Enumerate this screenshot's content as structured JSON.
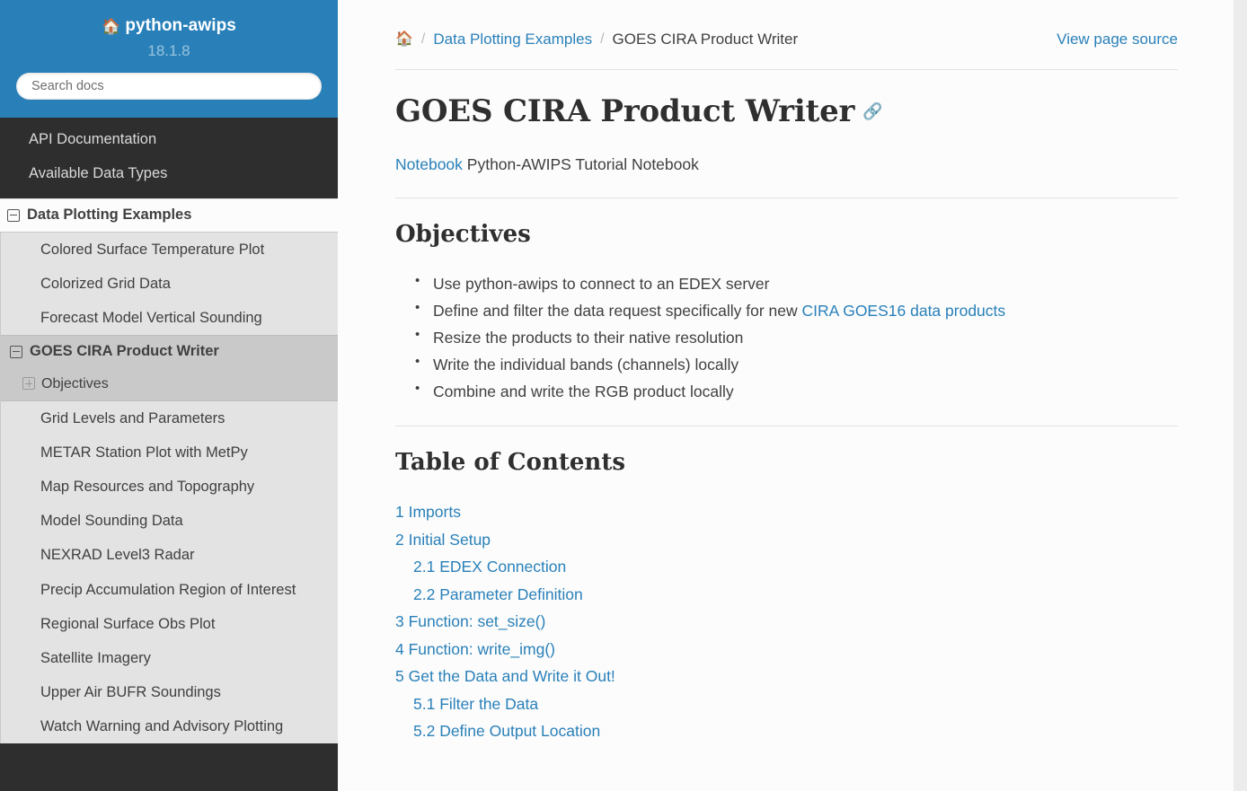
{
  "sidebar": {
    "brand": "python-awips",
    "brand_icon": "home-icon",
    "version": "18.1.8",
    "search_placeholder": "Search docs",
    "top_items": [
      {
        "label": "API Documentation"
      },
      {
        "label": "Available Data Types"
      }
    ],
    "current_root": {
      "label": "Data Plotting Examples",
      "toggle": "minus-box-icon"
    },
    "items": [
      {
        "label": "Colored Surface Temperature Plot",
        "active": false
      },
      {
        "label": "Colorized Grid Data",
        "active": false
      },
      {
        "label": "Forecast Model Vertical Sounding",
        "active": false
      },
      {
        "label": "GOES CIRA Product Writer",
        "active": true,
        "toggle": "minus-box-icon",
        "children": [
          {
            "label": "Objectives",
            "toggle": "plus-box-icon"
          }
        ]
      },
      {
        "label": "Grid Levels and Parameters",
        "active": false
      },
      {
        "label": "METAR Station Plot with MetPy",
        "active": false
      },
      {
        "label": "Map Resources and Topography",
        "active": false
      },
      {
        "label": "Model Sounding Data",
        "active": false
      },
      {
        "label": "NEXRAD Level3 Radar",
        "active": false
      },
      {
        "label": "Precip Accumulation Region of Interest",
        "active": false
      },
      {
        "label": "Regional Surface Obs Plot",
        "active": false
      },
      {
        "label": "Satellite Imagery",
        "active": false
      },
      {
        "label": "Upper Air BUFR Soundings",
        "active": false
      },
      {
        "label": "Watch Warning and Advisory Plotting",
        "active": false
      }
    ]
  },
  "breadcrumb": {
    "home_icon": "home-icon",
    "separator": "/",
    "parent": "Data Plotting Examples",
    "current": "GOES CIRA Product Writer",
    "view_source": "View page source"
  },
  "main": {
    "title": "GOES CIRA Product Writer",
    "headerlink_icon": "permalink-chain-icon",
    "lead_link": "Notebook",
    "lead_text": " Python-AWIPS Tutorial Notebook",
    "objectives_heading": "Objectives",
    "objectives": [
      {
        "pre": "Use python-awips to connect to an EDEX server",
        "link": "",
        "post": ""
      },
      {
        "pre": "Define and filter the data request specifically for new ",
        "link": "CIRA GOES16 data products",
        "post": ""
      },
      {
        "pre": "Resize the products to their native resolution",
        "link": "",
        "post": ""
      },
      {
        "pre": "Write the individual bands (channels) locally",
        "link": "",
        "post": ""
      },
      {
        "pre": "Combine and write the RGB product locally",
        "link": "",
        "post": ""
      }
    ],
    "toc_heading": "Table of Contents",
    "toc": [
      {
        "label": "1 Imports",
        "level": 1
      },
      {
        "label": "2 Initial Setup",
        "level": 1
      },
      {
        "label": "2.1 EDEX Connection",
        "level": 2
      },
      {
        "label": "2.2 Parameter Definition",
        "level": 2
      },
      {
        "label": "3 Function: set_size()",
        "level": 1
      },
      {
        "label": "4 Function: write_img()",
        "level": 1
      },
      {
        "label": "5 Get the Data and Write it Out!",
        "level": 1
      },
      {
        "label": "5.1 Filter the Data",
        "level": 2
      },
      {
        "label": "5.2 Define Output Location",
        "level": 2
      }
    ]
  },
  "colors": {
    "sidebar_header_blue": "#2980b9",
    "sidebar_dark": "#2e2e2e",
    "sidebar_nav_gray": "#e3e3e3",
    "sidebar_active_gray": "#c9c9c9",
    "link_blue": "#2980b9",
    "body_text": "#404040",
    "heading_text": "#2f2f2f",
    "page_background": "#ececec",
    "content_background": "#fcfcfc"
  }
}
